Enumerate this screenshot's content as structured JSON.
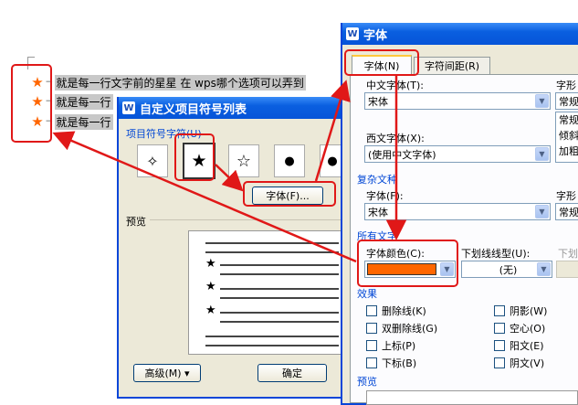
{
  "document": {
    "lines": [
      {
        "star": "★",
        "text": "就是每一行文字前的星星  在 wps哪个选项可以弄到"
      },
      {
        "star": "★",
        "text": "就是每一行"
      },
      {
        "star": "★",
        "text": "就是每一行"
      }
    ]
  },
  "bullet_dialog": {
    "title": "自定义项目符号列表",
    "icon_letter": "W",
    "symbol_group_label": "项目符号字符(U)",
    "symbols": [
      "✧",
      "★",
      "☆",
      "●",
      "●"
    ],
    "font_button": "字体(F)...",
    "preview_label": "预览",
    "preview_star": "★",
    "advanced_button": "高级(M) ▾",
    "ok_button": "确定"
  },
  "font_dialog": {
    "title": "字体",
    "icon_letter": "W",
    "tabs": [
      "字体(N)",
      "字符间距(R)"
    ],
    "chinese_font_label": "中文字体(T):",
    "chinese_font_value": "宋体",
    "style_label": "字形",
    "style_value": "常规",
    "style_options": [
      "常规",
      "倾斜",
      "加粗"
    ],
    "western_font_label": "西文字体(X):",
    "western_font_value": "(使用中文字体)",
    "complex_group": "复杂文种",
    "complex_font_label": "字体(F):",
    "complex_font_value": "宋体",
    "complex_style_label": "字形",
    "complex_style_value": "常规",
    "all_text_group": "所有文字",
    "font_color_label": "字体颜色(C):",
    "font_color": "#ff6600",
    "underline_label": "下划线线型(U):",
    "underline_value": "(无)",
    "underline_color_label": "下划线",
    "effects_group": "效果",
    "effects_left": [
      "删除线(K)",
      "双删除线(G)",
      "上标(P)",
      "下标(B)"
    ],
    "effects_right": [
      "阴影(W)",
      "空心(O)",
      "阳文(E)",
      "阴文(V)"
    ],
    "preview_group": "预览"
  }
}
